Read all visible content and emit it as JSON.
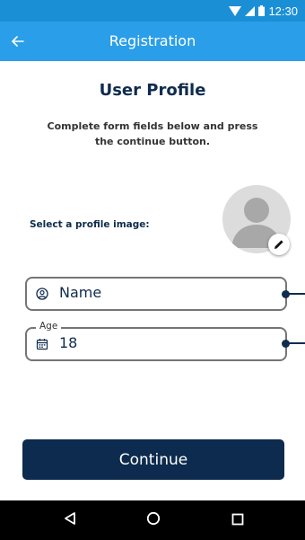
{
  "status_bar": {
    "time": "12:30",
    "icons": [
      "wifi-icon",
      "signal-icon",
      "battery-icon"
    ]
  },
  "app_bar": {
    "title": "Registration",
    "back_icon": "arrow-left-icon"
  },
  "main": {
    "title": "User Profile",
    "instructions": "Complete form fields below and press the continue button.",
    "profile_image_label": "Select a profile image:",
    "avatar_icon": "person-placeholder-icon",
    "edit_icon": "pencil-icon"
  },
  "form": {
    "name_field": {
      "icon": "user-circle-icon",
      "value": "Name"
    },
    "age_field": {
      "label": "Age",
      "icon": "calendar-icon",
      "value": "18"
    }
  },
  "actions": {
    "continue_label": "Continue"
  },
  "nav_bar": {
    "icons": [
      "back-triangle-icon",
      "home-circle-icon",
      "recents-square-icon"
    ]
  },
  "colors": {
    "status_bar": "#1b8fd6",
    "app_bar": "#2a9ee8",
    "primary_dark": "#0d2b4e",
    "field_border": "#757575",
    "avatar_bg": "#dcdcdc"
  }
}
